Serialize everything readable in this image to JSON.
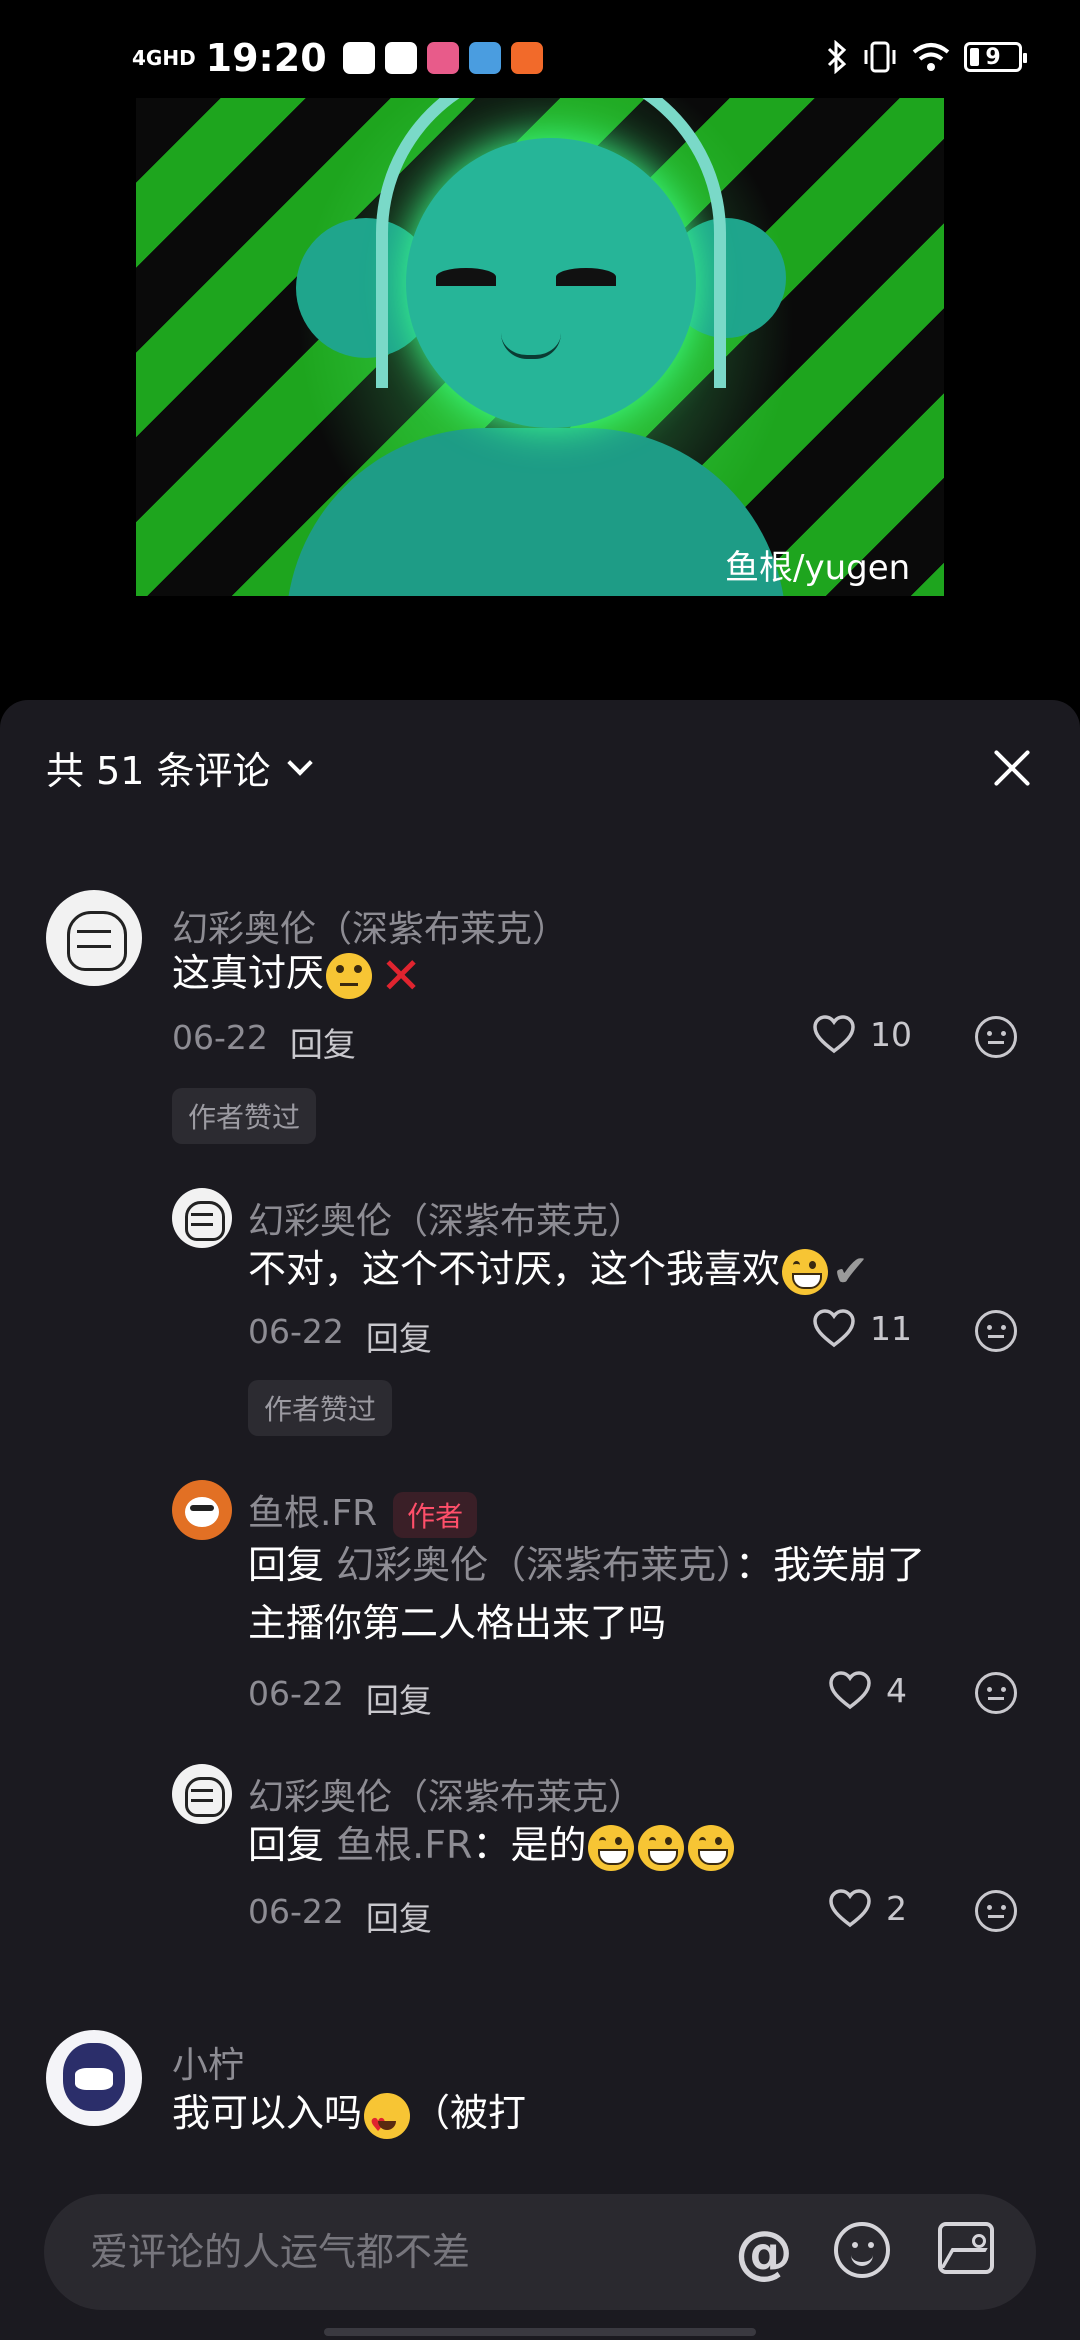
{
  "status_bar": {
    "network": "4GHD",
    "time": "19:20",
    "battery_level": "9",
    "icons": [
      "bluetooth-icon",
      "vibrate-icon",
      "wifi-icon",
      "battery-icon"
    ]
  },
  "video": {
    "watermark": "鱼根/yugen"
  },
  "comments_header": {
    "title": "共 51 条评论"
  },
  "comments": [
    {
      "user": "幻彩奥伦（深紫布莱克）",
      "text": "这真讨厌",
      "date": "06-22",
      "reply_label": "回复",
      "likes": "10",
      "badge": "作者赞过"
    },
    {
      "user": "幻彩奥伦（深紫布莱克）",
      "text": "不对，这个不讨厌，这个我喜欢",
      "date": "06-22",
      "reply_label": "回复",
      "likes": "11",
      "badge": "作者赞过"
    },
    {
      "user": "鱼根.FR",
      "author_tag": "作者",
      "reply_prefix": "回复",
      "reply_target": "幻彩奥伦（深紫布莱克）",
      "text_line1": "：我笑崩了",
      "text_line2": "主播你第二人格出来了吗",
      "date": "06-22",
      "reply_label": "回复",
      "likes": "4"
    },
    {
      "user": "幻彩奥伦（深紫布莱克）",
      "reply_prefix": "回复",
      "reply_target": "鱼根.FR",
      "text": "：是的",
      "date": "06-22",
      "reply_label": "回复",
      "likes": "2"
    },
    {
      "user": "小柠",
      "text_before": "我可以入吗",
      "text_after": "（被打"
    }
  ],
  "input_bar": {
    "placeholder": "爱评论的人运气都不差",
    "at_symbol": "@"
  },
  "colors": {
    "sheet_bg": "#1b1a20",
    "author_tag": "#ff4f6a",
    "muted_text": "#8d8c93"
  }
}
